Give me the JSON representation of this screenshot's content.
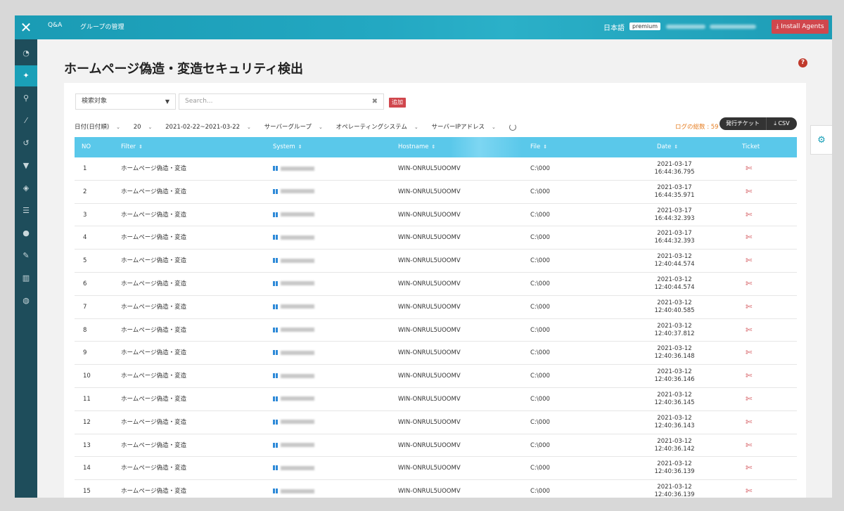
{
  "topbar": {
    "nav": [
      "Q&A",
      "グループの管理"
    ],
    "language": "日本語",
    "plan_badge": "premium",
    "install_label": "Install Agents"
  },
  "sidebar": {
    "icons": [
      "dashboard-icon",
      "crosshair-icon",
      "search-icon",
      "wand-icon",
      "history-icon",
      "filter-icon",
      "shield-icon",
      "list-icon",
      "alert-icon",
      "edit-icon",
      "chart-icon",
      "globe-icon"
    ]
  },
  "page": {
    "title": "ホームページ偽造・変造セキュリティ検出"
  },
  "toolbar": {
    "select_label": "検索対象",
    "search_placeholder": "Search...",
    "add_label": "追加",
    "filters": [
      "日付(日付順)",
      "20",
      "2021-02-22~2021-03-22",
      "サーバーグループ",
      "オペレーティングシステム",
      "サーバーIPアドレス"
    ],
    "log_count": "ログの総数 : 59",
    "ticket_label": "発行チケット",
    "csv_label": "CSV"
  },
  "table": {
    "headers": [
      "NO",
      "Filter",
      "System",
      "Hostname",
      "File",
      "Date",
      "Ticket"
    ],
    "rows": [
      {
        "no": "1",
        "filter": "ホームページ偽造・変造",
        "hostname": "WIN-ONRUL5UOOMV",
        "file": "C:\\000",
        "date": "2021-03-17",
        "time": "16:44:36.795"
      },
      {
        "no": "2",
        "filter": "ホームページ偽造・変造",
        "hostname": "WIN-ONRUL5UOOMV",
        "file": "C:\\000",
        "date": "2021-03-17",
        "time": "16:44:35.971"
      },
      {
        "no": "3",
        "filter": "ホームページ偽造・変造",
        "hostname": "WIN-ONRUL5UOOMV",
        "file": "C:\\000",
        "date": "2021-03-17",
        "time": "16:44:32.393"
      },
      {
        "no": "4",
        "filter": "ホームページ偽造・変造",
        "hostname": "WIN-ONRUL5UOOMV",
        "file": "C:\\000",
        "date": "2021-03-17",
        "time": "16:44:32.393"
      },
      {
        "no": "5",
        "filter": "ホームページ偽造・変造",
        "hostname": "WIN-ONRUL5UOOMV",
        "file": "C:\\000",
        "date": "2021-03-12",
        "time": "12:40:44.574"
      },
      {
        "no": "6",
        "filter": "ホームページ偽造・変造",
        "hostname": "WIN-ONRUL5UOOMV",
        "file": "C:\\000",
        "date": "2021-03-12",
        "time": "12:40:44.574"
      },
      {
        "no": "7",
        "filter": "ホームページ偽造・変造",
        "hostname": "WIN-ONRUL5UOOMV",
        "file": "C:\\000",
        "date": "2021-03-12",
        "time": "12:40:40.585"
      },
      {
        "no": "8",
        "filter": "ホームページ偽造・変造",
        "hostname": "WIN-ONRUL5UOOMV",
        "file": "C:\\000",
        "date": "2021-03-12",
        "time": "12:40:37.812"
      },
      {
        "no": "9",
        "filter": "ホームページ偽造・変造",
        "hostname": "WIN-ONRUL5UOOMV",
        "file": "C:\\000",
        "date": "2021-03-12",
        "time": "12:40:36.148"
      },
      {
        "no": "10",
        "filter": "ホームページ偽造・変造",
        "hostname": "WIN-ONRUL5UOOMV",
        "file": "C:\\000",
        "date": "2021-03-12",
        "time": "12:40:36.146"
      },
      {
        "no": "11",
        "filter": "ホームページ偽造・変造",
        "hostname": "WIN-ONRUL5UOOMV",
        "file": "C:\\000",
        "date": "2021-03-12",
        "time": "12:40:36.145"
      },
      {
        "no": "12",
        "filter": "ホームページ偽造・変造",
        "hostname": "WIN-ONRUL5UOOMV",
        "file": "C:\\000",
        "date": "2021-03-12",
        "time": "12:40:36.143"
      },
      {
        "no": "13",
        "filter": "ホームページ偽造・変造",
        "hostname": "WIN-ONRUL5UOOMV",
        "file": "C:\\000",
        "date": "2021-03-12",
        "time": "12:40:36.142"
      },
      {
        "no": "14",
        "filter": "ホームページ偽造・変造",
        "hostname": "WIN-ONRUL5UOOMV",
        "file": "C:\\000",
        "date": "2021-03-12",
        "time": "12:40:36.139"
      },
      {
        "no": "15",
        "filter": "ホームページ偽造・変造",
        "hostname": "WIN-ONRUL5UOOMV",
        "file": "C:\\000",
        "date": "2021-03-12",
        "time": "12:40:36.139"
      }
    ]
  },
  "colors": {
    "topbar": "#1a9bb4",
    "sidebar": "#1e4d5b",
    "table_header": "#5ac8ea",
    "danger": "#d0474d",
    "log_count": "#e67e22"
  }
}
